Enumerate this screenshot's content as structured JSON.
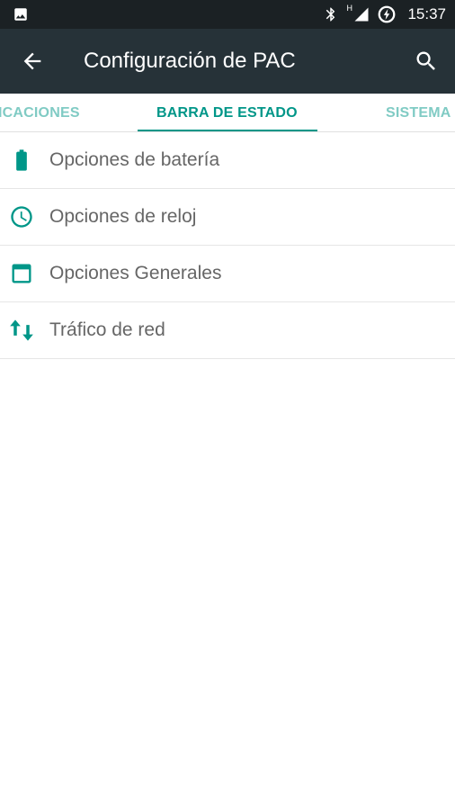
{
  "status_bar": {
    "time": "15:37",
    "signal_label": "H",
    "icons": [
      "image-icon",
      "bluetooth-icon",
      "signal-icon",
      "battery-saver-icon"
    ]
  },
  "app_bar": {
    "title": "Configuración de PAC",
    "back_icon": "arrow-left-icon",
    "search_icon": "search-icon"
  },
  "tabs": [
    {
      "label": "ICACIONES",
      "active": false
    },
    {
      "label": "BARRA DE ESTADO",
      "active": true
    },
    {
      "label": "SISTEMA",
      "active": false
    }
  ],
  "list": {
    "items": [
      {
        "label": "Opciones de batería",
        "icon": "battery-icon"
      },
      {
        "label": "Opciones de reloj",
        "icon": "clock-icon"
      },
      {
        "label": "Opciones Generales",
        "icon": "window-icon"
      },
      {
        "label": "Tráfico de red",
        "icon": "swap-vertical-icon"
      }
    ]
  },
  "colors": {
    "status_bar_bg": "#1b2124",
    "app_bar_bg": "#263238",
    "accent": "#009688",
    "tab_inactive": "#80cbc4",
    "text_secondary": "#666666"
  }
}
